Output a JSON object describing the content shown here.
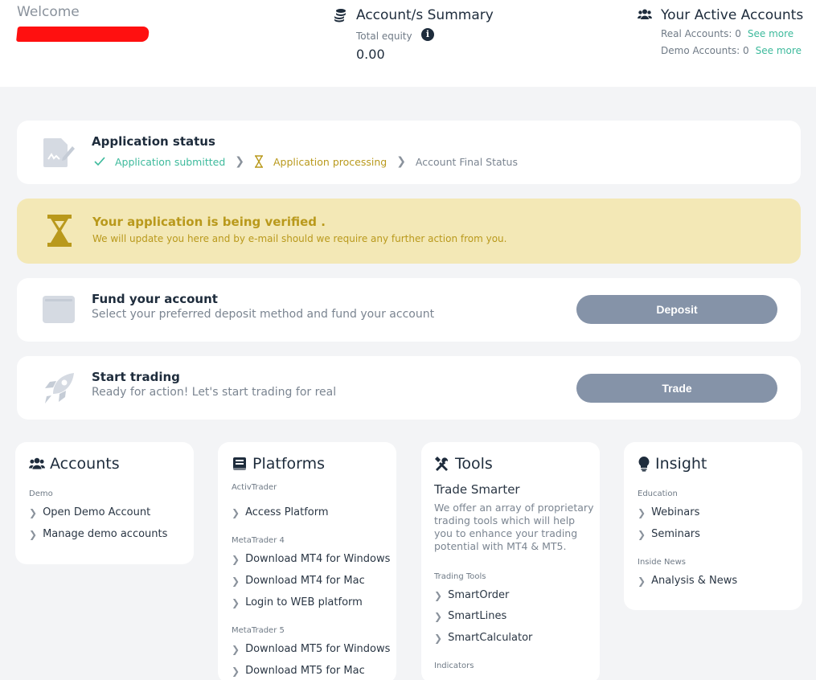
{
  "header": {
    "welcome": "Welcome",
    "summary": {
      "title": "Account/s Summary",
      "equity_label": "Total equity",
      "equity_value": "0.00"
    },
    "active": {
      "title": "Your Active Accounts",
      "real_label": "Real Accounts: 0",
      "demo_label": "Demo Accounts: 0",
      "see_more": "See more"
    }
  },
  "application": {
    "title": "Application status",
    "steps": [
      "Application submitted",
      "Application processing",
      "Account Final Status"
    ]
  },
  "verify": {
    "title": "Your application is being verified .",
    "subtitle": "We will update you here and by e-mail should we require any further action from you."
  },
  "fund": {
    "title": "Fund your account",
    "subtitle": "Select your preferred deposit method and fund your account",
    "button": "Deposit"
  },
  "trade": {
    "title": "Start trading",
    "subtitle": "Ready for action! Let's start trading for real",
    "button": "Trade"
  },
  "accounts": {
    "title": "Accounts",
    "section": "Demo",
    "items": [
      "Open Demo Account",
      "Manage demo accounts"
    ]
  },
  "platforms": {
    "title": "Platforms",
    "sections": [
      {
        "label": "ActivTrader",
        "items": [
          "Access Platform"
        ]
      },
      {
        "label": "MetaTrader 4",
        "items": [
          "Download MT4 for Windows",
          "Download MT4 for Mac",
          "Login to WEB platform"
        ]
      },
      {
        "label": "MetaTrader 5",
        "items": [
          "Download MT5 for Windows",
          "Download MT5 for Mac"
        ]
      }
    ]
  },
  "tools": {
    "title": "Tools",
    "subtitle": "Trade Smarter",
    "description": "We offer an array of proprietary trading tools which will help you to enhance your trading potential with MT4 & MT5.",
    "section": "Trading Tools",
    "items": [
      "SmartOrder",
      "SmartLines",
      "SmartCalculator"
    ],
    "section2": "Indicators"
  },
  "insight": {
    "title": "Insight",
    "sections": [
      {
        "label": "Education",
        "items": [
          "Webinars",
          "Seminars"
        ]
      },
      {
        "label": "Inside News",
        "items": [
          "Analysis & News"
        ]
      }
    ]
  },
  "colors": {
    "navy": "#1e2c3c",
    "green": "#3dba9c",
    "gold": "#b9991c",
    "warn_bg": "#f3e8b6",
    "button": "#8593a8"
  }
}
